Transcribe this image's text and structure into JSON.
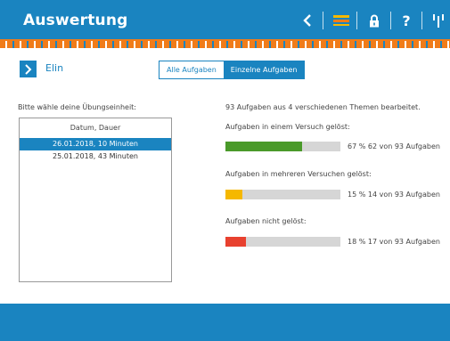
{
  "header": {
    "title": "Auswertung",
    "icons": [
      "chevron-left-icon",
      "list-icon",
      "lock-icon",
      "help-icon",
      "antenna-icon"
    ],
    "help_label": "?",
    "colors": {
      "primary": "#1a84c0",
      "accent": "#f07c1a"
    }
  },
  "student": {
    "name": "Elin"
  },
  "tabs": [
    {
      "label": "Alle Aufgaben",
      "active": false
    },
    {
      "label": "Einzelne Aufgaben",
      "active": true
    }
  ],
  "session_panel": {
    "prompt": "Bitte wähle deine Übungseinheit:",
    "column_header": "Datum, Dauer",
    "items": [
      {
        "label": "26.01.2018, 10 Minuten",
        "selected": true
      },
      {
        "label": "25.01.2018, 43 Minuten",
        "selected": false
      }
    ]
  },
  "results": {
    "summary": "93 Aufgaben aus 4 verschiedenen Themen bearbeitet.",
    "stats": [
      {
        "label": "Aufgaben in einem Versuch gelöst:",
        "percent": 67,
        "text": "67 % 62 von 93 Aufgaben",
        "color": "#4a9a2a"
      },
      {
        "label": "Aufgaben in mehreren Versuchen gelöst:",
        "percent": 15,
        "text": "15 % 14 von 93 Aufgaben",
        "color": "#f5b800"
      },
      {
        "label": "Aufgaben nicht gelöst:",
        "percent": 18,
        "text": "18 % 17 von 93 Aufgaben",
        "color": "#e8412f"
      }
    ]
  }
}
